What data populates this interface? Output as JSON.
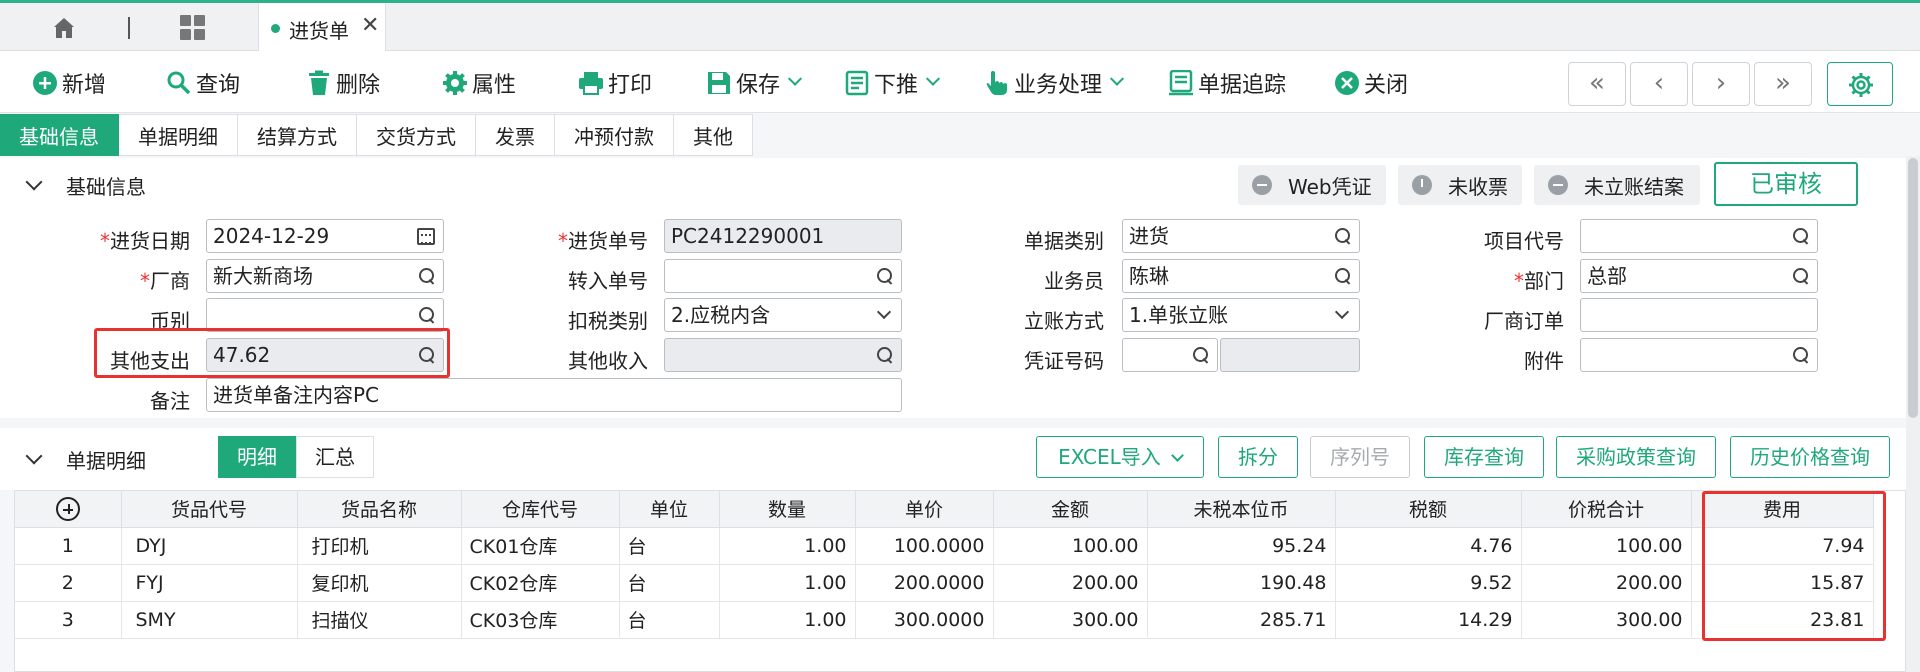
{
  "window": {
    "active_tab": "进货单"
  },
  "toolbar": {
    "new": "新增",
    "query": "查询",
    "delete": "删除",
    "properties": "属性",
    "print": "打印",
    "save": "保存",
    "push_down": "下推",
    "business": "业务处理",
    "trace": "单据追踪",
    "close": "关闭"
  },
  "subtabs": [
    "基础信息",
    "单据明细",
    "结算方式",
    "交货方式",
    "发票",
    "冲预付款",
    "其他"
  ],
  "basic_section": {
    "title": "基础信息",
    "badges": [
      "Web凭证",
      "未收票",
      "未立账结案"
    ],
    "status": "已审核"
  },
  "form": {
    "purchase_date": {
      "label": "进货日期",
      "value": "2024-12-29"
    },
    "vendor": {
      "label": "厂商",
      "value": "新大新商场"
    },
    "currency": {
      "label": "币别",
      "value": ""
    },
    "other_expense": {
      "label": "其他支出",
      "value": "47.62"
    },
    "remark": {
      "label": "备注",
      "value": "进货单备注内容PC"
    },
    "doc_no": {
      "label": "进货单号",
      "value": "PC2412290001"
    },
    "import_no": {
      "label": "转入单号",
      "value": ""
    },
    "tax_type": {
      "label": "扣税类别",
      "value": "2.应税内含"
    },
    "other_income": {
      "label": "其他收入",
      "value": ""
    },
    "doc_category": {
      "label": "单据类别",
      "value": "进货"
    },
    "salesperson": {
      "label": "业务员",
      "value": "陈琳"
    },
    "account_method": {
      "label": "立账方式",
      "value": "1.单张立账"
    },
    "voucher_no": {
      "label": "凭证号码",
      "value": ""
    },
    "project_code": {
      "label": "项目代号",
      "value": ""
    },
    "department": {
      "label": "部门",
      "value": "总部"
    },
    "vendor_order": {
      "label": "厂商订单",
      "value": ""
    },
    "attachment": {
      "label": "附件",
      "value": ""
    }
  },
  "detail_section": {
    "title": "单据明细",
    "views": [
      "明细",
      "汇总"
    ],
    "buttons": [
      "EXCEL导入",
      "拆分",
      "序列号",
      "库存查询",
      "采购政策查询",
      "历史价格查询"
    ]
  },
  "table": {
    "columns": [
      "货品代号",
      "货品名称",
      "仓库代号",
      "单位",
      "数量",
      "单价",
      "金额",
      "未税本位币",
      "税额",
      "价税合计",
      "费用"
    ],
    "rows": [
      {
        "idx": "1",
        "code": "DYJ",
        "name": "打印机",
        "wh": "CK01仓库",
        "unit": "台",
        "qty": "1.00",
        "price": "100.0000",
        "amount": "100.00",
        "pretax": "95.24",
        "tax": "4.76",
        "total": "100.00",
        "fee": "7.94"
      },
      {
        "idx": "2",
        "code": "FYJ",
        "name": "复印机",
        "wh": "CK02仓库",
        "unit": "台",
        "qty": "1.00",
        "price": "200.0000",
        "amount": "200.00",
        "pretax": "190.48",
        "tax": "9.52",
        "total": "200.00",
        "fee": "15.87"
      },
      {
        "idx": "3",
        "code": "SMY",
        "name": "扫描仪",
        "wh": "CK03仓库",
        "unit": "台",
        "qty": "1.00",
        "price": "300.0000",
        "amount": "300.00",
        "pretax": "285.71",
        "tax": "14.29",
        "total": "300.00",
        "fee": "23.81"
      }
    ]
  },
  "colors": {
    "accent": "#1fa97a",
    "highlight": "#e8322f"
  }
}
